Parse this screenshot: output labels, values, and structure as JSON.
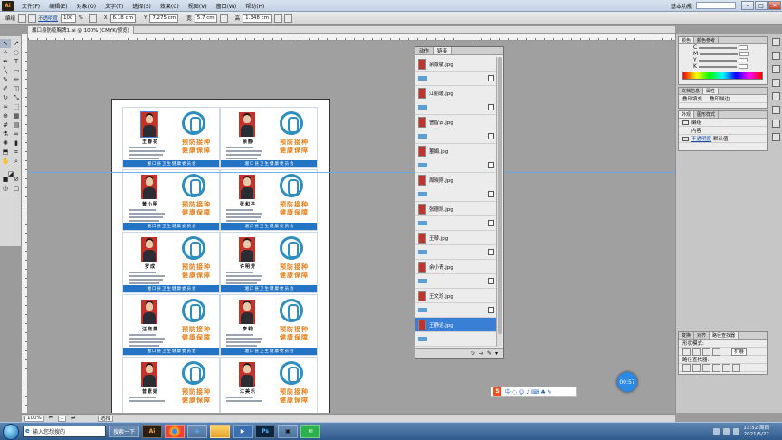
{
  "menubar": {
    "app_logo": "Ai",
    "items": [
      "文件(F)",
      "编辑(E)",
      "对象(O)",
      "文字(T)",
      "选择(S)",
      "效果(C)",
      "视图(V)",
      "窗口(W)",
      "帮助(H)"
    ],
    "workspace": "基本功能",
    "window_buttons": [
      "–",
      "□",
      "✕"
    ]
  },
  "controlbar": {
    "label": "编组",
    "opacity_label": "不透明度",
    "opacity_value": "100",
    "opacity_unit": "%",
    "x_label": "X",
    "x_value": "6.18 cm",
    "y_label": "Y",
    "y_value": "7.275 cm",
    "w_label": "宽",
    "w_value": "5.7 cm",
    "h_label": "高",
    "h_value": "1.348 cm"
  },
  "document": {
    "tab_title": "湘口县防疫胸牌1.ai @ 100% (CMYK/预览)",
    "zoom": "100%",
    "page": "1",
    "status": "选择"
  },
  "cards": [
    {
      "name": "王春花",
      "footer": "湘口县卫生健康委员会",
      "slogan1": "预防接种",
      "slogan2": "健康保障"
    },
    {
      "name": "余静",
      "footer": "湘口县卫生健康委员会",
      "slogan1": "预防接种",
      "slogan2": "健康保障"
    },
    {
      "name": "黄小明",
      "footer": "湘口县卫生健康委员会",
      "slogan1": "预防接种",
      "slogan2": "健康保障"
    },
    {
      "name": "张和平",
      "footer": "湘口县卫生健康委员会",
      "slogan1": "预防接种",
      "slogan2": "健康保障"
    },
    {
      "name": "罗成",
      "footer": "湘口县卫生健康委员会",
      "slogan1": "预防接种",
      "slogan2": "健康保障"
    },
    {
      "name": "许明芳",
      "footer": "湘口县卫生健康委员会",
      "slogan1": "预防接种",
      "slogan2": "健康保障"
    },
    {
      "name": "汪晓燕",
      "footer": "湘口县卫生健康委员会",
      "slogan1": "预防接种",
      "slogan2": "健康保障"
    },
    {
      "name": "李莉",
      "footer": "湘口县卫生健康委员会",
      "slogan1": "预防接种",
      "slogan2": "健康保障"
    },
    {
      "name": "曾素娟",
      "footer": "",
      "slogan1": "预防接种",
      "slogan2": "健康保障"
    },
    {
      "name": "江美乐",
      "footer": "",
      "slogan1": "预防接种",
      "slogan2": "健康保障"
    }
  ],
  "links_panel": {
    "tabs": [
      "动作",
      "链接"
    ],
    "items": [
      "余景敏.jpg",
      "江丽璇.jpg",
      "曹智云.jpg",
      "董娟.jpg",
      "周晓刚.jpg",
      "张德凯.jpg",
      "王琴.jpg",
      "余小青.jpg",
      "王文珍.jpg",
      "王静远.jpg"
    ],
    "selected": "王静远.jpg",
    "footer_icons": [
      "↻",
      "⇥",
      "✎",
      "▾"
    ]
  },
  "color_panel": {
    "tabs": [
      "颜色",
      "颜色参考"
    ],
    "channels": [
      "C",
      "M",
      "Y",
      "K"
    ]
  },
  "appearance_panel": {
    "tabs": [
      "外观",
      "图形样式"
    ],
    "rows": [
      "编组",
      "内容"
    ],
    "link_text": "不透明度",
    "link_suffix": "默认值"
  },
  "doc_panel": {
    "tabs": [
      "文档信息",
      "属性"
    ],
    "items": [
      "叠印填充",
      "叠印描边"
    ]
  },
  "pathfinder_panel": {
    "tabs": [
      "变换",
      "对齐",
      "路径查找器"
    ],
    "label1": "形状模式:",
    "button": "扩展",
    "label2": "路径查找器:"
  },
  "ime": {
    "logo": "S",
    "text": "中·◌ ☺ ♪ ⌨ ♣ ✎"
  },
  "timer": "00:57",
  "taskbar": {
    "search_placeholder": "输入您想搜的",
    "search_button": "搜索一下",
    "apps": [
      "Ai",
      "Ps"
    ],
    "time": "13:52 周四",
    "date": "2021/5/27"
  }
}
